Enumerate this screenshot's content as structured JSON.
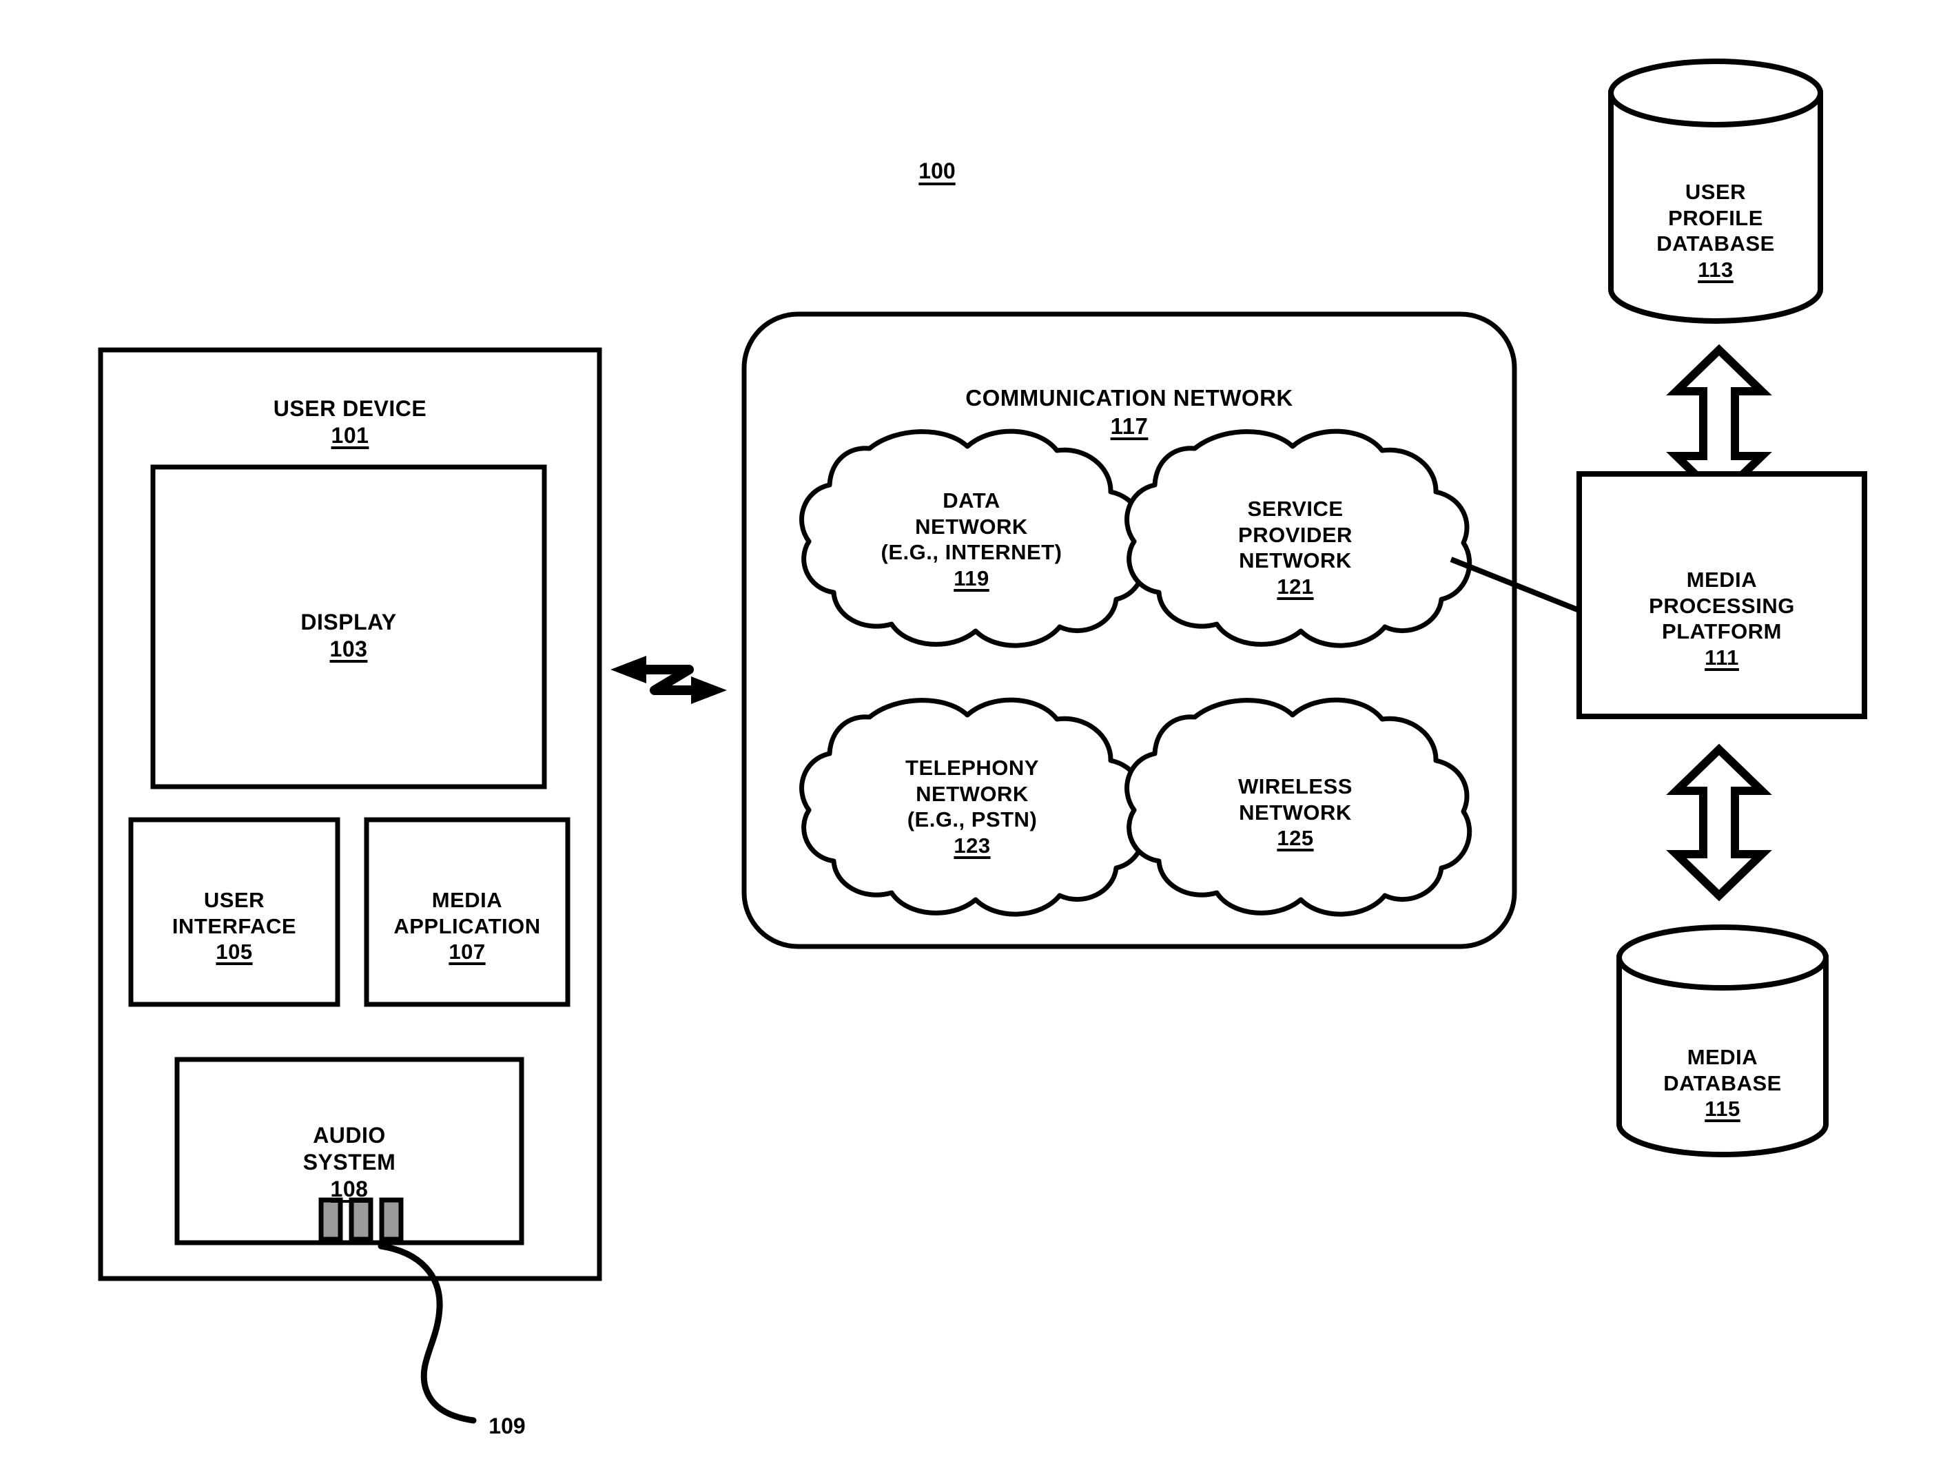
{
  "figure": {
    "number": "100"
  },
  "user_device": {
    "title": "USER DEVICE",
    "number": "101",
    "display": {
      "title": "DISPLAY",
      "number": "103"
    },
    "user_interface": {
      "title": "USER\nINTERFACE",
      "number": "105"
    },
    "media_application": {
      "title": "MEDIA\nAPPLICATION",
      "number": "107"
    },
    "audio_system": {
      "title": "AUDIO\nSYSTEM",
      "number": "108"
    },
    "speaker": {
      "callout_number": "109"
    }
  },
  "communication_network": {
    "title": "COMMUNICATION NETWORK",
    "number": "117",
    "clouds": [
      {
        "name": "data-network",
        "title": "DATA\nNETWORK\n(E.G., INTERNET)",
        "number": "119"
      },
      {
        "name": "service-provider-network",
        "title": "SERVICE\nPROVIDER\nNETWORK",
        "number": "121"
      },
      {
        "name": "telephony-network",
        "title": "TELEPHONY\nNETWORK\n(E.G., PSTN)",
        "number": "123"
      },
      {
        "name": "wireless-network",
        "title": "WIRELESS\nNETWORK",
        "number": "125"
      }
    ]
  },
  "user_profile_database": {
    "title": "USER\nPROFILE\nDATABASE",
    "number": "113"
  },
  "media_processing_platform": {
    "title": "MEDIA\nPROCESSING\nPLATFORM",
    "number": "111"
  },
  "media_database": {
    "title": "MEDIA\nDATABASE",
    "number": "115"
  },
  "colors": {
    "stroke": "#000000",
    "background": "#ffffff",
    "speaker_fill": "#9a9a9a"
  }
}
